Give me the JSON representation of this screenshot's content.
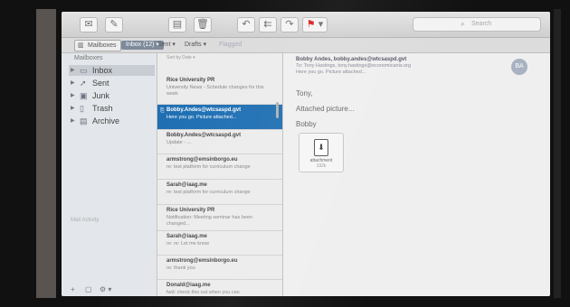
{
  "toolbar": {
    "icons": [
      "compose-icon",
      "edit-icon",
      "archive-icon",
      "trash-icon",
      "reply-icon",
      "reply-all-icon",
      "forward-icon",
      "flag-icon"
    ],
    "search_placeholder": "Search"
  },
  "favorites": {
    "mailboxes_label": "Mailboxes",
    "inbox_label": "Inbox (12) ▾",
    "sent_label": "Sent ▾",
    "drafts_label": "Drafts ▾",
    "flagged_label": "Flagged"
  },
  "sidebar": {
    "header": "Mailboxes",
    "items": [
      {
        "label": "Inbox",
        "icon": "inbox-icon"
      },
      {
        "label": "Sent",
        "icon": "paper-plane-icon"
      },
      {
        "label": "Junk",
        "icon": "junk-icon"
      },
      {
        "label": "Trash",
        "icon": "trash-icon"
      },
      {
        "label": "Archive",
        "icon": "archive-box-icon"
      }
    ],
    "activity": "Mail Activity"
  },
  "list": {
    "sort_label": "Sort by Date ▾",
    "messages": [
      {
        "from": "Rice University PR",
        "preview": "University News - Schedule changes for this week"
      },
      {
        "from": "Bobby.Andes@wtcsaspd.gvt",
        "preview": "Here you go. Picture attached..."
      },
      {
        "from": "Bobby.Andes@wtcsaspd.gvt",
        "preview": "Update - ..."
      },
      {
        "from": "armstrong@emsinborgo.eu",
        "preview": "re: test platform for curriculum change"
      },
      {
        "from": "Sarah@iaag.me",
        "preview": "re: test platform for curriculum change"
      },
      {
        "from": "Rice University PR",
        "preview": "Notification: Meeting seminar has been changed..."
      },
      {
        "from": "Sarah@iaag.me",
        "preview": "re: re: Let me know"
      },
      {
        "from": "armstrong@emsinborgo.eu",
        "preview": "re: thank you"
      },
      {
        "from": "Donald@iaag.me",
        "preview": "fwd: check this out when you can"
      }
    ]
  },
  "reader": {
    "from": "Bobby Andes, bobby.andes@wtcsaspd.gvt",
    "to": "To: Tony Hastings, tony.hastings@economicanis.org",
    "subject": "Here you go. Picture attached...",
    "avatar_initials": "BA",
    "body": [
      "Tony,",
      "Attached picture...",
      "Bobby"
    ],
    "attachment": {
      "name": "attachment",
      "size": "192k"
    }
  }
}
